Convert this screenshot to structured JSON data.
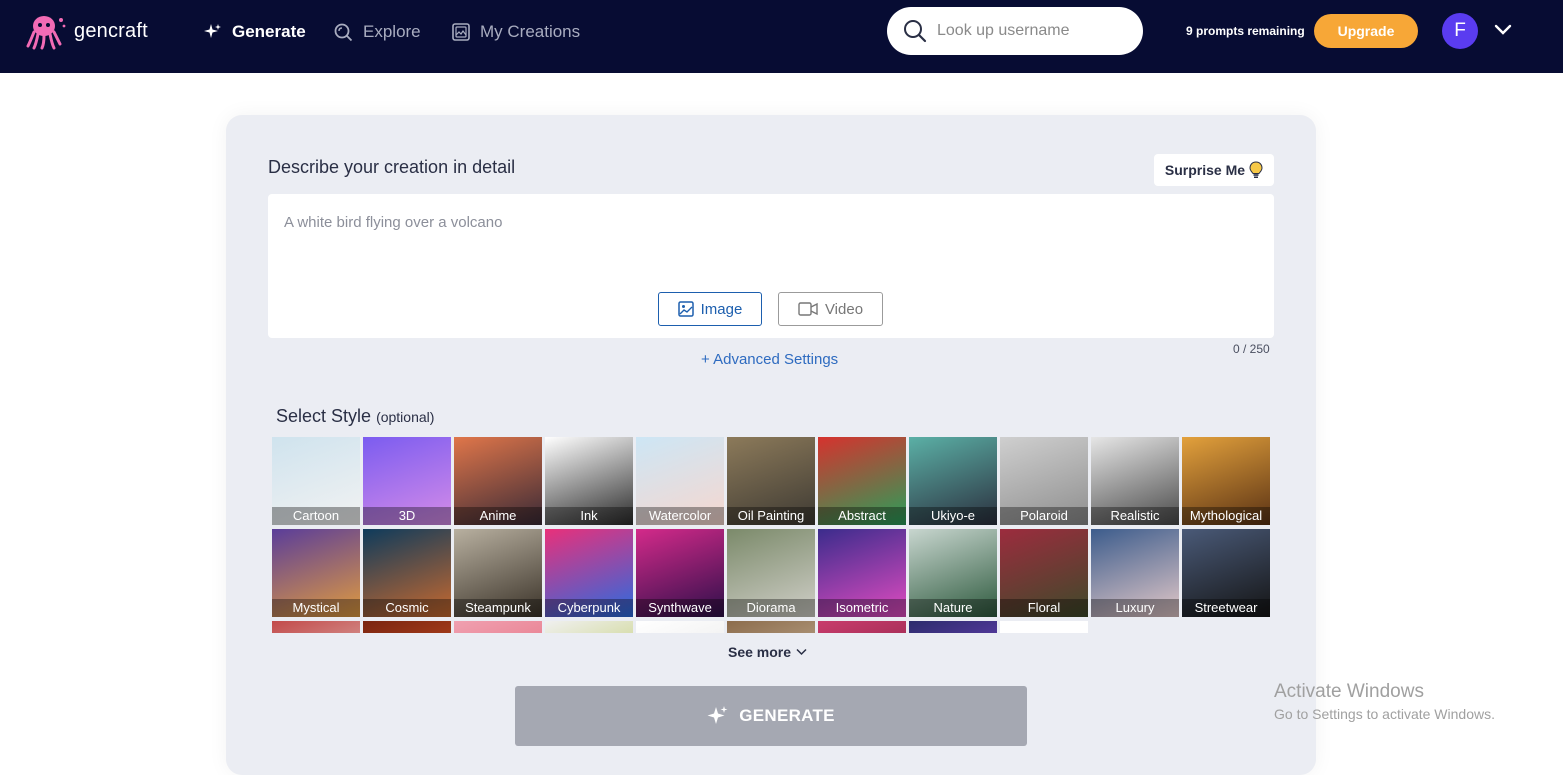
{
  "header": {
    "logo_text": "gencraft",
    "nav": [
      {
        "label": "Generate",
        "icon": "sparkle-icon",
        "active": true
      },
      {
        "label": "Explore",
        "icon": "explore-search-icon",
        "active": false
      },
      {
        "label": "My Creations",
        "icon": "gallery-icon",
        "active": false
      }
    ],
    "search_placeholder": "Look up username",
    "prompts_remaining": "9 prompts remaining",
    "upgrade_label": "Upgrade",
    "avatar_initial": "F"
  },
  "form": {
    "describe_label": "Describe your creation in detail",
    "surprise_label": "Surprise Me",
    "prompt_placeholder": "A white bird flying over a volcano",
    "image_label": "Image",
    "video_label": "Video",
    "counter": "0 / 250",
    "advanced_label": "+ Advanced Settings"
  },
  "styles": {
    "title": "Select Style",
    "optional": "(optional)",
    "items": [
      {
        "label": "Cartoon",
        "colors": [
          "#cfe3ee",
          "#f2f2f2"
        ]
      },
      {
        "label": "3D",
        "colors": [
          "#7b5cf0",
          "#d58ce8"
        ]
      },
      {
        "label": "Anime",
        "colors": [
          "#e0764a",
          "#3a2a36"
        ]
      },
      {
        "label": "Ink",
        "colors": [
          "#ffffff",
          "#2b2b2b"
        ]
      },
      {
        "label": "Watercolor",
        "colors": [
          "#cde6f5",
          "#f6d7cf"
        ]
      },
      {
        "label": "Oil Painting",
        "colors": [
          "#8c7a5a",
          "#3e3a33"
        ]
      },
      {
        "label": "Abstract",
        "colors": [
          "#d6322e",
          "#28a05a"
        ]
      },
      {
        "label": "Ukiyo-e",
        "colors": [
          "#5bb0a6",
          "#2b2f3e"
        ]
      },
      {
        "label": "Polaroid",
        "colors": [
          "#cfcfcf",
          "#8e8e8e"
        ]
      },
      {
        "label": "Realistic",
        "colors": [
          "#e6e6e6",
          "#4a4a4a"
        ]
      },
      {
        "label": "Mythological",
        "colors": [
          "#e3a13c",
          "#5a3214"
        ]
      },
      {
        "label": "Mystical",
        "colors": [
          "#5a3d9a",
          "#e09b3f"
        ]
      },
      {
        "label": "Cosmic",
        "colors": [
          "#0e3b5c",
          "#c8692e"
        ]
      },
      {
        "label": "Steampunk",
        "colors": [
          "#b8b0a0",
          "#3a3228"
        ]
      },
      {
        "label": "Cyberpunk",
        "colors": [
          "#e9307a",
          "#2a6ce0"
        ]
      },
      {
        "label": "Synthwave",
        "colors": [
          "#d42a8a",
          "#2d0f4a"
        ]
      },
      {
        "label": "Diorama",
        "colors": [
          "#7b8a6a",
          "#d0cfc8"
        ]
      },
      {
        "label": "Isometric",
        "colors": [
          "#3b2c8c",
          "#e04cc0"
        ]
      },
      {
        "label": "Nature",
        "colors": [
          "#c8d6cf",
          "#2e5a3e"
        ]
      },
      {
        "label": "Floral",
        "colors": [
          "#9c2c3e",
          "#3e4a2a"
        ]
      },
      {
        "label": "Luxury",
        "colors": [
          "#3c5c8c",
          "#e2c8c8"
        ]
      },
      {
        "label": "Streetwear",
        "colors": [
          "#4a5a78",
          "#141414"
        ]
      },
      {
        "label": "",
        "colors": [
          "#c24a4a",
          "#e8e0d8"
        ]
      },
      {
        "label": "",
        "colors": [
          "#7a2410",
          "#e0602a"
        ]
      },
      {
        "label": "",
        "colors": [
          "#f0a0b0",
          "#e06070"
        ]
      },
      {
        "label": "",
        "colors": [
          "#f0f0f0",
          "#b0c040"
        ]
      },
      {
        "label": "",
        "colors": [
          "#ffffff",
          "#e0e0e0"
        ]
      },
      {
        "label": "",
        "colors": [
          "#8c6c4c",
          "#d8c8b0"
        ]
      },
      {
        "label": "",
        "colors": [
          "#c83c6c",
          "#7a1c3c"
        ]
      },
      {
        "label": "",
        "colors": [
          "#2c2c6c",
          "#8c4ce0"
        ]
      },
      {
        "label": "",
        "colors": [
          "#ffffff",
          "#ffffff"
        ]
      }
    ],
    "see_more": "See more"
  },
  "generate_label": "GENERATE",
  "watermark": {
    "line1": "Activate Windows",
    "line2": "Go to Settings to activate Windows."
  },
  "colors": {
    "topbar": "#070c33",
    "accent_blue": "#1d5fae",
    "upgrade": "#f7a737",
    "avatar": "#5a3cf0",
    "card": "#ebedf3"
  }
}
